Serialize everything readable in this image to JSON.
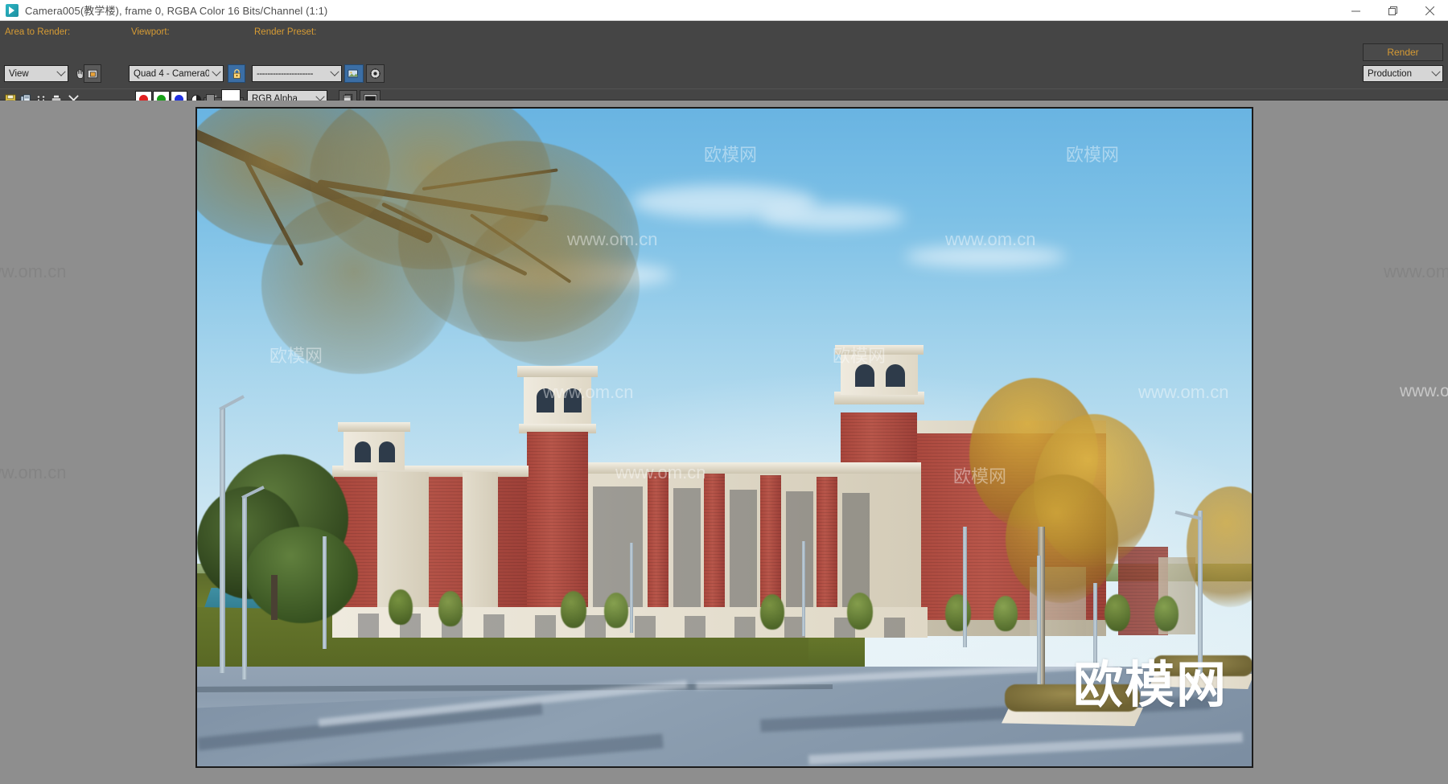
{
  "window": {
    "title": "Camera005(教学楼), frame 0, RGBA Color 16 Bits/Channel (1:1)",
    "icon": "render-frame-window-icon",
    "minimize": "minimize-icon",
    "maximize": "maximize-icon",
    "close": "close-icon"
  },
  "toolbar": {
    "area_label": "Area to Render:",
    "area_value": "View",
    "viewport_label": "Viewport:",
    "viewport_value": "Quad 4 - Camera0",
    "preset_label": "Render Preset:",
    "preset_value": "---------------------",
    "render_button": "Render",
    "render_mode": "Production",
    "channel_value": "RGB Alpha",
    "icons": {
      "region_pick": "hand-icon",
      "region_window": "region-window-icon",
      "viewport_lock": "padlock-icon",
      "preset_load": "load-preset-icon",
      "preset_settings": "gear-icon",
      "save_image": "save-floppy-icon",
      "clone": "clone-window-icon",
      "print": "print-icon",
      "clear": "clear-x-icon",
      "pixel_compare": "compare-icon",
      "red_channel": "red-channel-icon",
      "green_channel": "green-channel-icon",
      "blue_channel": "blue-channel-icon",
      "alpha_channel": "alpha-channel-icon",
      "mono_channel": "mono-channel-icon",
      "color_swatch": "background-color-swatch",
      "toggle_ui": "toggle-ui-icon",
      "display_alpha": "display-alpha-icon"
    }
  },
  "colors": {
    "accent_orange": "#d69b34",
    "panel_dark": "#454545",
    "stage_gray": "#8e8e8e",
    "combo_light": "#d6d6d6",
    "channel_red": "#e02020",
    "channel_green": "#18a018",
    "channel_blue": "#2030e0"
  },
  "render": {
    "scene": "exterior architectural visualization of a red-brick and stone campus teaching building with plaza, lawn, street lamps and autumn trees",
    "watermarks": [
      "www.om.cn",
      "欧模网"
    ],
    "brand_text": "欧模网"
  }
}
